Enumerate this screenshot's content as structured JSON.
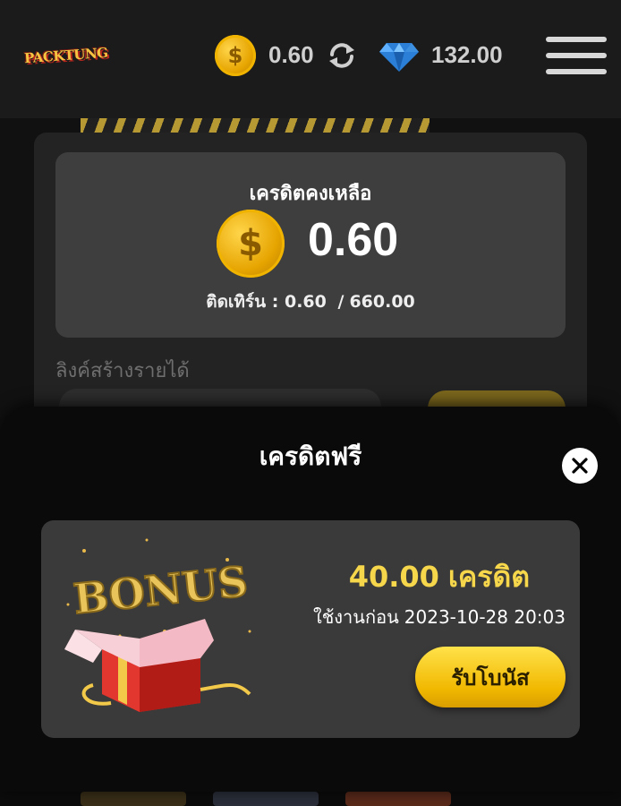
{
  "header": {
    "logo_text": "PACKTUNG",
    "credit_value": "0.60",
    "gem_value": "132.00",
    "coin_icon": "dollar-coin-icon",
    "refresh_icon": "refresh-icon",
    "gem_icon": "diamond-icon",
    "menu_icon": "hamburger-menu-icon"
  },
  "balance": {
    "title": "เครดิตคงเหลือ",
    "amount": "0.60",
    "turnover_label": "ติดเทิร์น :",
    "turnover_current": "0.60",
    "turnover_separator": "/",
    "turnover_target": "660.00"
  },
  "referral": {
    "label": "ลิงค์สร้างรายได้"
  },
  "modal": {
    "title": "เครดิตฟรี",
    "close_icon": "close-icon",
    "bonus": {
      "art_text": "BONUS",
      "amount": "40.00",
      "amount_unit": "เครดิต",
      "expire_label": "ใช้งานก่อน",
      "expire_date": "2023-10-28 20:03",
      "claim_label": "รับโบนัส"
    }
  },
  "colors": {
    "accent_yellow": "#f6d64a",
    "button_yellow": "#f1b800",
    "card_bg": "#3b3a3a",
    "header_bg": "#1b1b1b"
  }
}
